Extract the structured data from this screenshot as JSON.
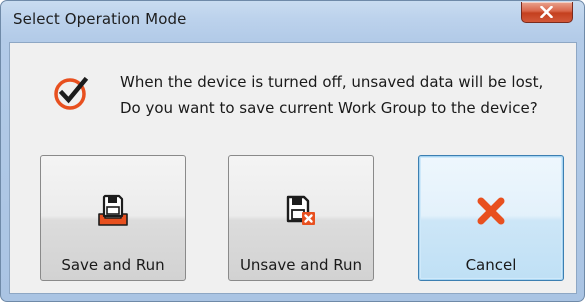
{
  "window": {
    "title": "Select Operation Mode"
  },
  "message": {
    "line1": "When the device is turned off, unsaved data will be lost,",
    "line2": "Do you want to save current Work Group to the device?",
    "icon": "check-circle-icon"
  },
  "buttons": {
    "save_and_run": {
      "label": "Save and Run",
      "icon": "save-icon"
    },
    "unsave_and_run": {
      "label": "Unsave and Run",
      "icon": "unsave-icon"
    },
    "cancel": {
      "label": "Cancel",
      "icon": "cancel-x-icon"
    }
  },
  "colors": {
    "accent": "#e8501f",
    "title_bar": "#bcd2ec",
    "close_button": "#c4401f"
  }
}
